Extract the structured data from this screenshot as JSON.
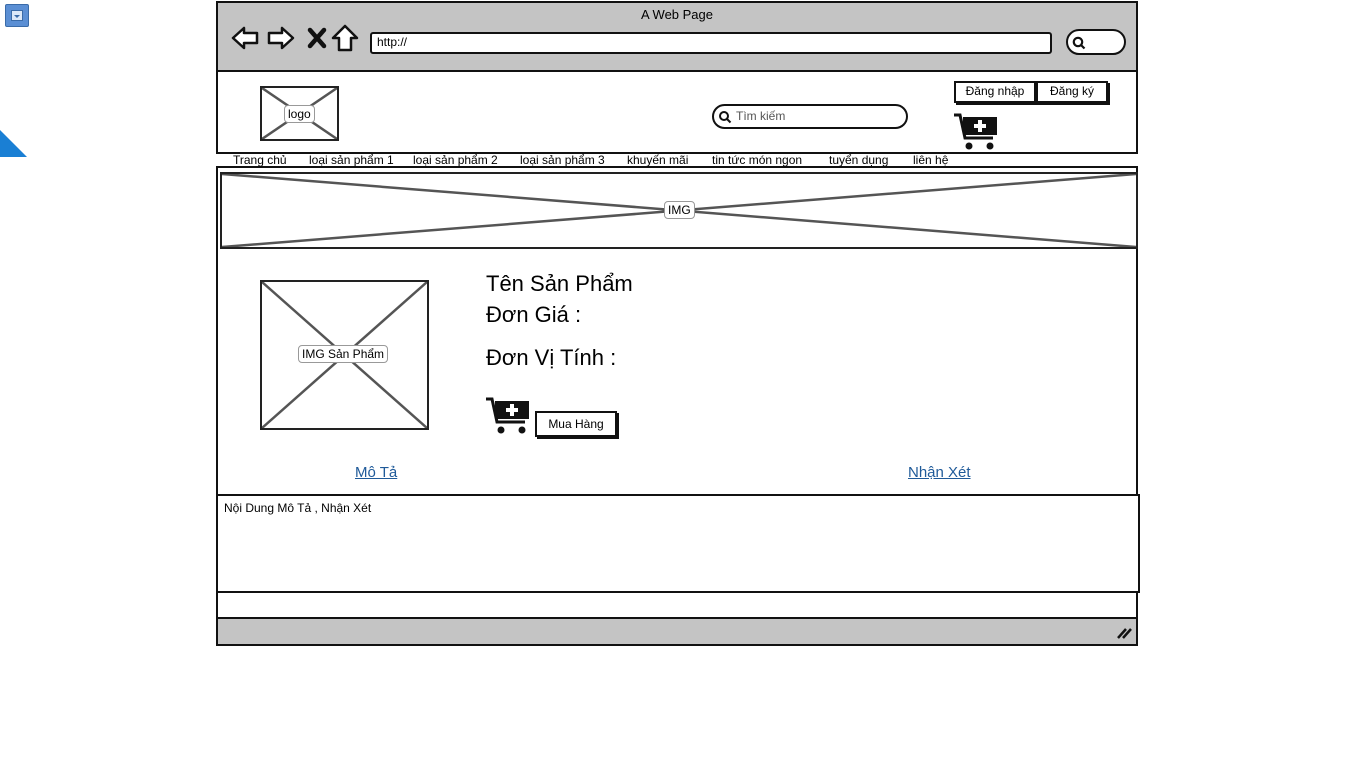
{
  "window": {
    "title": "A Web Page",
    "url": "http://"
  },
  "header": {
    "logo_label": "logo",
    "search_placeholder": "Tìm kiếm",
    "login_label": "Đăng nhập",
    "register_label": "Đăng ký"
  },
  "menu": {
    "items": [
      "Trang chủ",
      "loại sản phẩm 1",
      "loại sản phẩm 2",
      "loại sản phẩm 3",
      "khuyến mãi",
      "tin tức món ngon",
      "tuyển dụng",
      "liên hệ"
    ]
  },
  "banner": {
    "label": "IMG"
  },
  "product": {
    "image_label": "IMG Sản Phẩm",
    "name": "Tên Sản Phẩm",
    "price": "Đơn Giá :",
    "unit": "Đơn Vị Tính :",
    "buy_label": "Mua Hàng"
  },
  "tabs": {
    "description": "Mô Tả",
    "reviews": "Nhận Xét"
  },
  "content": {
    "text": "Nội Dung Mô Tả , Nhận Xét"
  }
}
